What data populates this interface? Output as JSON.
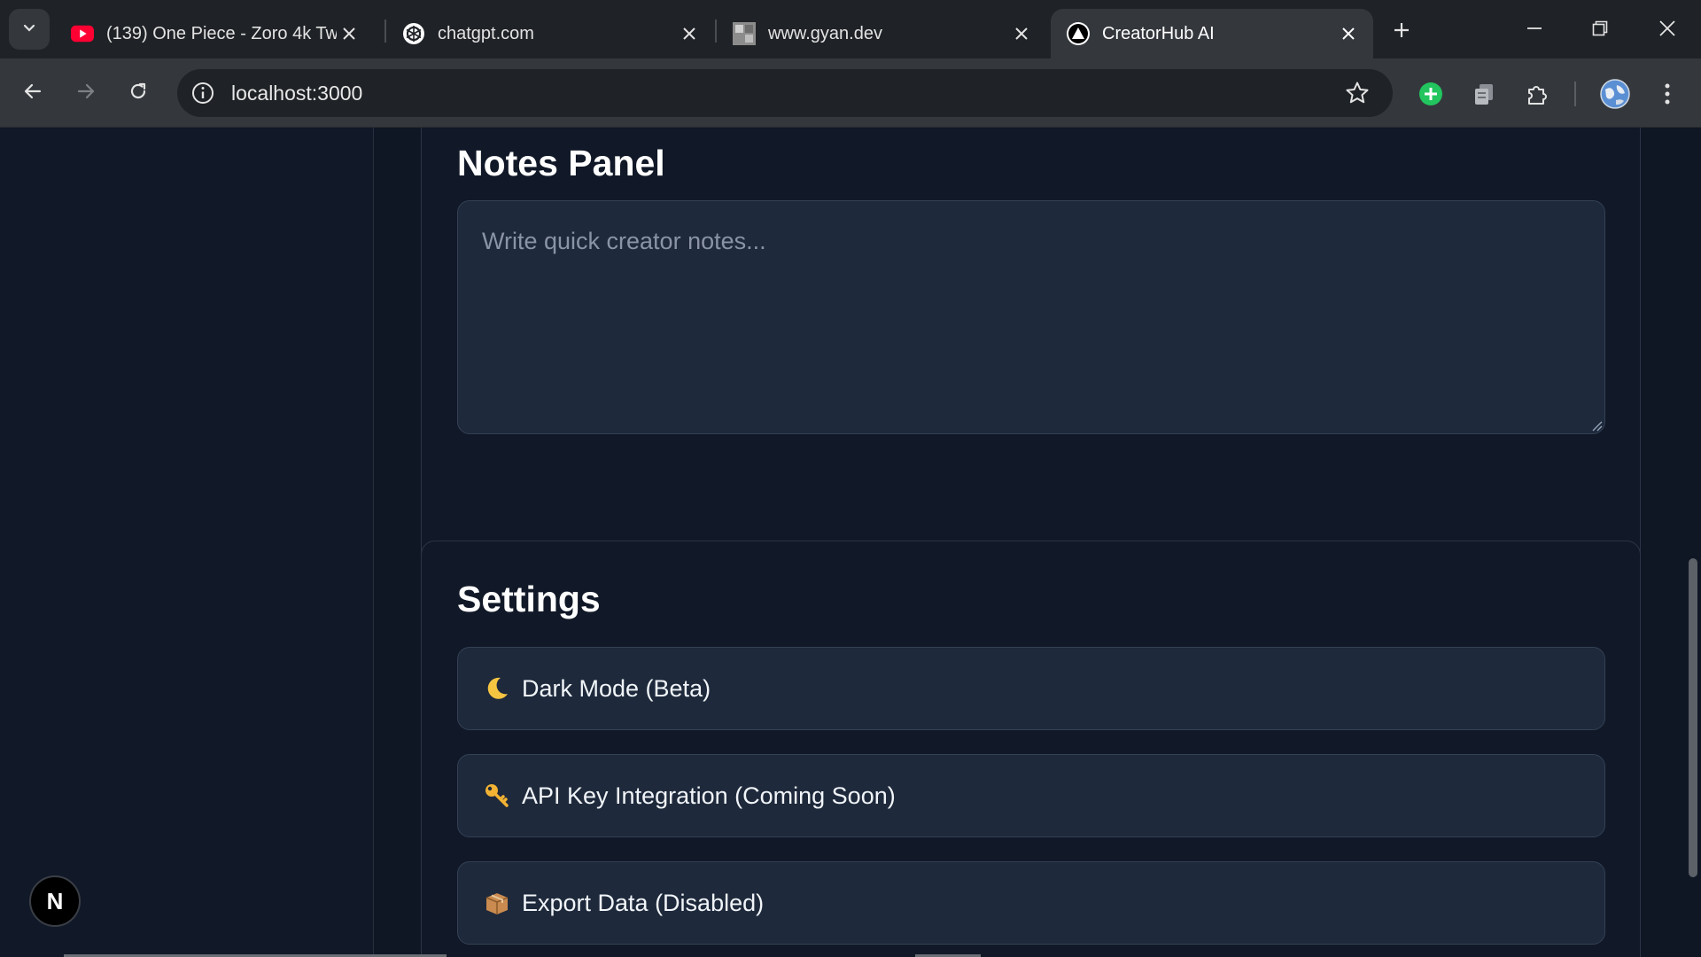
{
  "browser": {
    "tabs": [
      {
        "title": "(139) One Piece - Zoro 4k Twi",
        "favicon": "youtube-icon",
        "active": false
      },
      {
        "title": "chatgpt.com",
        "favicon": "openai-icon",
        "active": false
      },
      {
        "title": "www.gyan.dev",
        "favicon": "site-thumbnail-icon",
        "active": false
      },
      {
        "title": "CreatorHub AI",
        "favicon": "triangle-logo-icon",
        "active": true
      }
    ],
    "address": "localhost:3000"
  },
  "notes": {
    "title": "Notes Panel",
    "placeholder": "Write quick creator notes...",
    "value": ""
  },
  "settings": {
    "title": "Settings",
    "items": [
      {
        "emoji": "moon-icon",
        "label": "Dark Mode (Beta)"
      },
      {
        "emoji": "key-icon",
        "label": "API Key Integration (Coming Soon)"
      },
      {
        "emoji": "package-icon",
        "label": "Export Data (Disabled)"
      }
    ]
  },
  "devtools_badge": "N",
  "colors": {
    "page_bg": "#0f1624",
    "card_bg": "#111827",
    "field_bg": "#1e293b",
    "border": "#334155"
  }
}
